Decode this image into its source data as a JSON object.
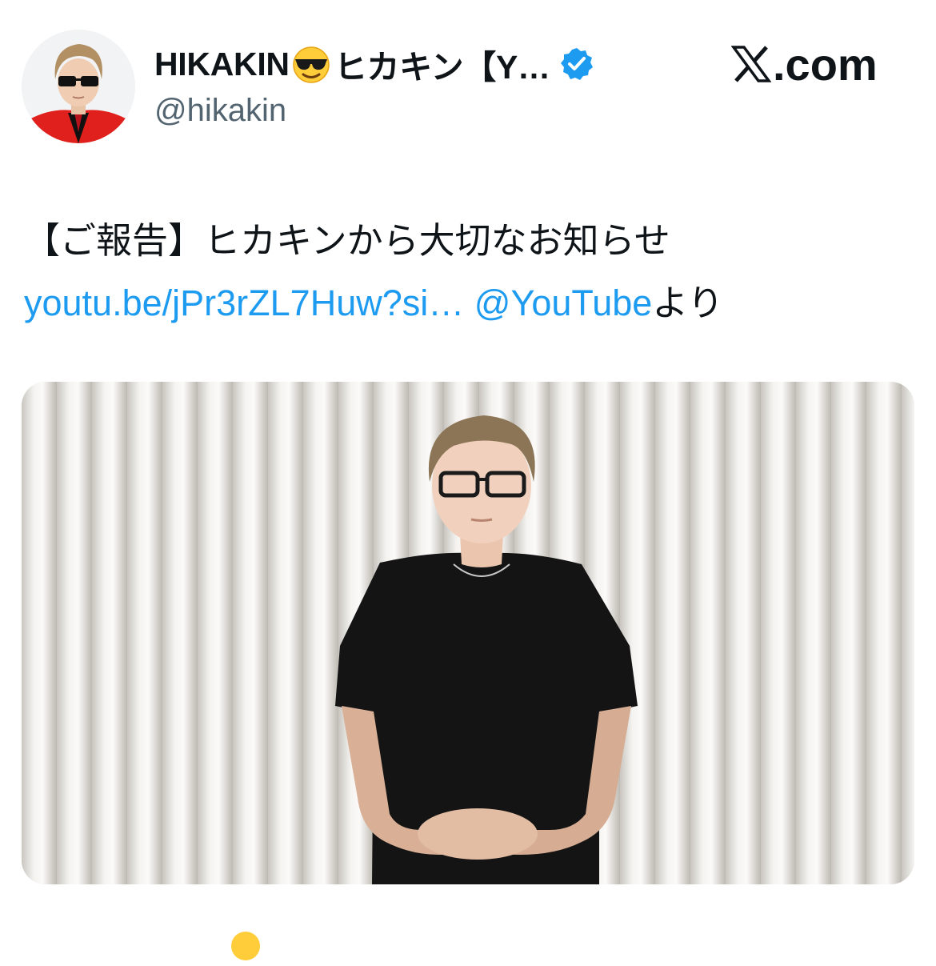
{
  "tweet": {
    "author": {
      "display_name": "HIKAKIN",
      "display_emoji": "sunglasses-emoji",
      "display_name_suffix": "ヒカキン【Y…",
      "verified": true,
      "handle": "@hikakin",
      "avatar_icon": "avatar-photo"
    },
    "brand": {
      "site_suffix": ".com",
      "logo_icon": "x-logo-icon"
    },
    "body": {
      "line1": "【ご報告】ヒカキンから大切なお知らせ",
      "link_url": "youtu.be/jPr3rZL7Huw?si…",
      "mention": "@YouTube",
      "line2_suffix": "より"
    },
    "media": {
      "icon": "photo-man-black-tshirt-curtain"
    }
  },
  "colors": {
    "link": "#1d9bf0",
    "text": "#0f1419",
    "secondary": "#536471",
    "verified_badge": "#1d9bf0"
  }
}
